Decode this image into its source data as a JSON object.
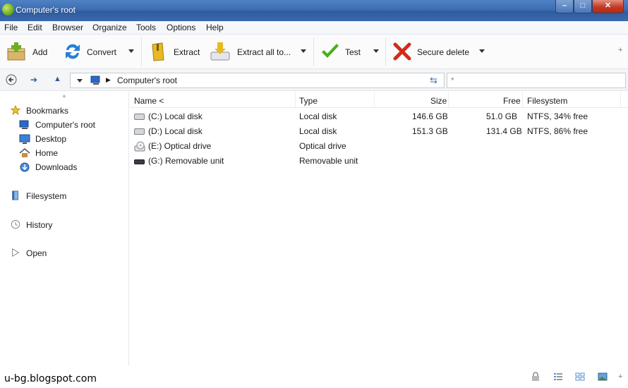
{
  "window": {
    "title": "Computer's root"
  },
  "menu": [
    "File",
    "Edit",
    "Browser",
    "Organize",
    "Tools",
    "Options",
    "Help"
  ],
  "toolbar": {
    "add": "Add",
    "convert": "Convert",
    "extract": "Extract",
    "extract_all": "Extract all to...",
    "test": "Test",
    "secure_delete": "Secure delete"
  },
  "address": {
    "path": "Computer's root",
    "filter_placeholder": "*"
  },
  "sidebar": {
    "bookmarks": "Bookmarks",
    "bookmark_items": [
      "Computer's root",
      "Desktop",
      "Home",
      "Downloads"
    ],
    "filesystem": "Filesystem",
    "history": "History",
    "open": "Open"
  },
  "columns": {
    "name": "Name <",
    "type": "Type",
    "size": "Size",
    "free": "Free",
    "filesystem": "Filesystem"
  },
  "rows": [
    {
      "name": "(C:) Local disk",
      "type": "Local disk",
      "size": "146.6 GB",
      "free": "51.0 GB",
      "fs": "NTFS, 34% free"
    },
    {
      "name": "(D:) Local disk",
      "type": "Local disk",
      "size": "151.3 GB",
      "free": "131.4 GB",
      "fs": "NTFS, 86% free"
    },
    {
      "name": "(E:) Optical drive",
      "type": "Optical drive",
      "size": "",
      "free": "",
      "fs": ""
    },
    {
      "name": "(G:) Removable unit",
      "type": "Removable unit",
      "size": "",
      "free": "",
      "fs": ""
    }
  ],
  "status": {
    "watermark": "u-bg.blogspot.com"
  },
  "colors": {
    "title_bar": "#3e6db3",
    "close_button": "#c43a24",
    "add_icon": "#6fae1f",
    "extract_icon": "#e8b923",
    "test_check": "#4caf1c",
    "delete_x": "#d32a1a"
  }
}
